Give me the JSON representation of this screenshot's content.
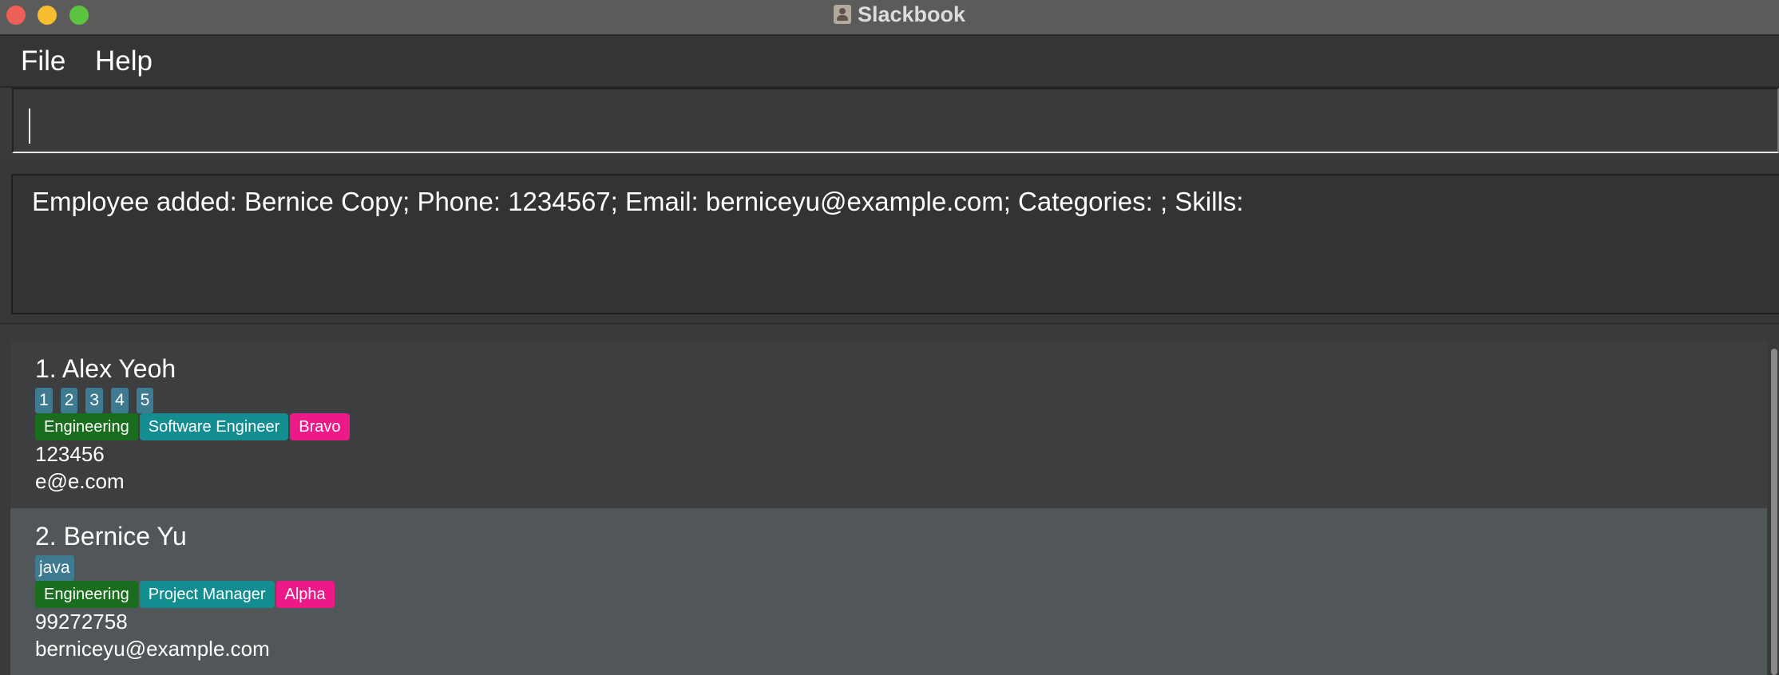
{
  "window": {
    "title": "Slackbook",
    "icon": "address-book-icon",
    "controls": [
      "close",
      "minimize",
      "maximize"
    ]
  },
  "menu": {
    "items": [
      {
        "label": "File"
      },
      {
        "label": "Help"
      }
    ]
  },
  "command": {
    "value": "",
    "placeholder": ""
  },
  "result": {
    "text": "Employee added: Bernice Copy; Phone: 1234567; Email: berniceyu@example.com; Categories: ; Skills:"
  },
  "employees": [
    {
      "name": "1. Alex Yeoh",
      "skills": [
        "1",
        "2",
        "3",
        "4",
        "5"
      ],
      "categories": [
        {
          "label": "Engineering",
          "color": "#1a6d1f"
        },
        {
          "label": "Software Engineer",
          "color": "#148d91"
        },
        {
          "label": "Bravo",
          "color": "#ee1989"
        }
      ],
      "phone": "123456",
      "email": "e@e.com"
    },
    {
      "name": "2. Bernice Yu",
      "skills": [
        "java"
      ],
      "categories": [
        {
          "label": "Engineering",
          "color": "#1a6d1f"
        },
        {
          "label": "Project Manager",
          "color": "#148d91"
        },
        {
          "label": "Alpha",
          "color": "#ee1989"
        }
      ],
      "phone": "99272758",
      "email": "berniceyu@example.com"
    }
  ],
  "colors": {
    "titlebar": "#5b5b5b",
    "background": "#3a3a3a",
    "card_odd": "#3c3e3f",
    "card_even": "#515658",
    "skill_tag": "#3e7b91"
  }
}
